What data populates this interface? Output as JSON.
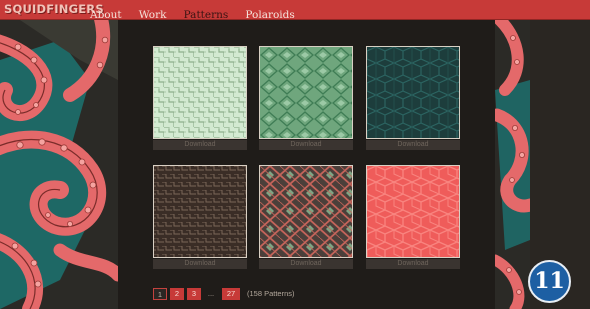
{
  "site": {
    "logo": "SQUIDFINGERS"
  },
  "nav": {
    "items": [
      "About",
      "Work",
      "Patterns",
      "Polaroids"
    ],
    "active": "Patterns"
  },
  "patterns": [
    {
      "download_label": "Download",
      "colors": {
        "bg": "#d3ead1",
        "fg": "#8fb08d"
      }
    },
    {
      "download_label": "Download",
      "colors": {
        "bg": "#6fa67d",
        "fg": "#3f7d55"
      }
    },
    {
      "download_label": "Download",
      "colors": {
        "bg": "#1d3d3c",
        "fg": "#2b6461"
      }
    },
    {
      "download_label": "Download",
      "colors": {
        "bg": "#3a2d26",
        "fg": "#7b6658"
      }
    },
    {
      "download_label": "Download",
      "colors": {
        "bg": "#4b3f3a",
        "fg": "#c4645a",
        "accent": "#7fa584"
      }
    },
    {
      "download_label": "Download",
      "colors": {
        "bg": "#ef5c5a",
        "fg": "#f9847f"
      }
    }
  ],
  "pagination": {
    "current": "1",
    "pages": [
      "2",
      "3"
    ],
    "ellipsis": "...",
    "last": "27",
    "count_text": "(158 Patterns)"
  },
  "badge": {
    "text": "11"
  },
  "colors": {
    "nav_bg": "#c73a38",
    "page_bg": "#2a2622",
    "panel_bg": "#1f1c19",
    "tentacle": "#e4696a",
    "sucker": "#f5a3a0",
    "teal": "#1d6f6d"
  }
}
